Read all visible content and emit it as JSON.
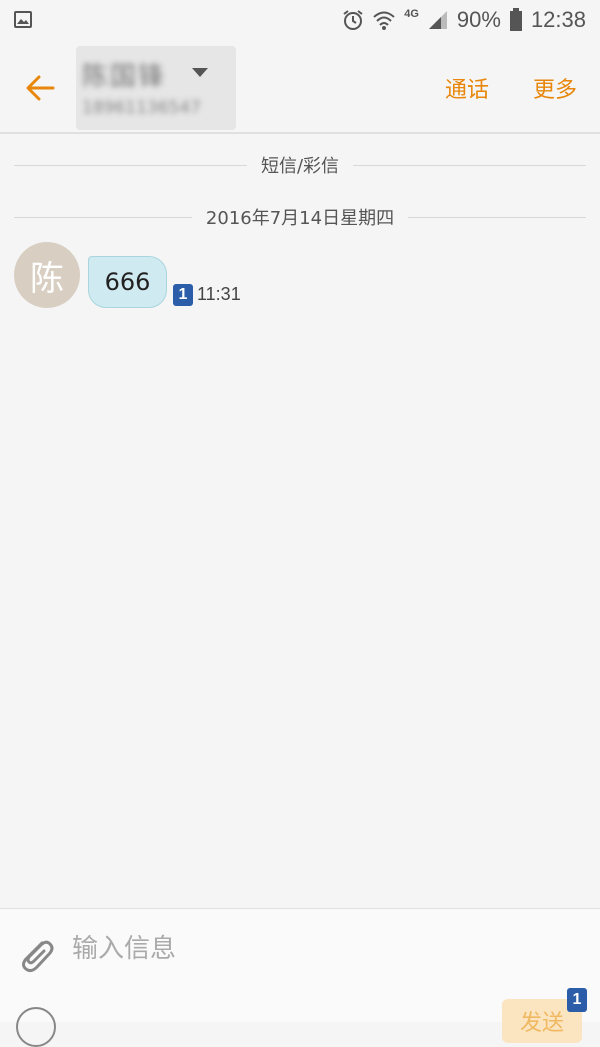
{
  "status_bar": {
    "network": "4G",
    "battery_percent": "90%",
    "time": "12:38",
    "icons": [
      "gallery-icon",
      "alarm-icon",
      "wifi-icon",
      "signal-icon",
      "battery-icon"
    ]
  },
  "header": {
    "contact_name": "陈国锋",
    "contact_number": "18961136547",
    "call_label": "通话",
    "more_label": "更多",
    "accent_color": "#e8870b"
  },
  "conversation": {
    "channel_label": "短信/彩信",
    "date_label": "2016年7月14日星期四",
    "messages": [
      {
        "avatar_initial": "陈",
        "text": "666",
        "sim_slot": "1",
        "time": "11:31"
      }
    ]
  },
  "composer": {
    "placeholder": "输入信息",
    "send_label": "发送",
    "sim_slot": "1"
  }
}
